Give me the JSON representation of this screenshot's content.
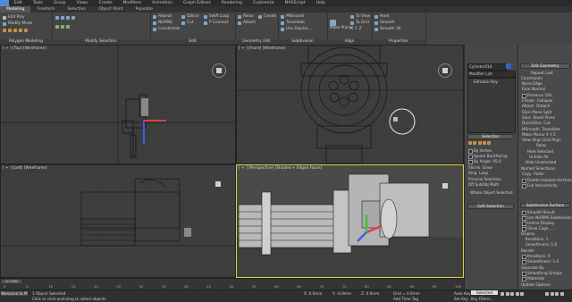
{
  "menu": [
    "Edit",
    "Tools",
    "Group",
    "Views",
    "Create",
    "Modifiers",
    "Animation",
    "Graph Editors",
    "Rendering",
    "Customize",
    "MAXScript",
    "Help"
  ],
  "tabs": [
    {
      "label": "Modeling",
      "active": true
    },
    {
      "label": "Freeform",
      "active": false
    },
    {
      "label": "Selection",
      "active": false
    },
    {
      "label": "Object Paint",
      "active": false
    },
    {
      "label": "Populate",
      "active": false
    }
  ],
  "ribbon": {
    "edit_poly_label": "Edit Poly",
    "modify_mode_label": "Modify Mode",
    "poly_groups": [
      "Polygon Modeling",
      "Modify Selection",
      "Edit",
      "Geometry (All)",
      "Subdivision",
      "Align",
      "Properties"
    ],
    "edit_buttons": [
      "Repeat",
      "QSlice",
      "Swift Loop",
      "NURMS",
      "Cut",
      "P Connect",
      "Constraints"
    ],
    "geometry_buttons": [
      "Relax",
      "Create",
      "Attach"
    ],
    "subdivision_buttons": [
      "MSmooth",
      "Tessellate",
      "Use Displac..."
    ],
    "align_buttons": [
      "Make Planar",
      "To View",
      "To Grid",
      "X",
      "Y",
      "Z"
    ],
    "properties_buttons": [
      "Hard",
      "Smooth",
      "Smooth 30"
    ]
  },
  "viewports": {
    "top": "[ + ] [Top] [Wireframe]",
    "front": "[ + ] [Front] [Wireframe]",
    "left": "[ + ] [Left] [Wireframe]",
    "perspective": "[ + ] [Perspective] [Shaded + Edged Faces]"
  },
  "command_panel": {
    "object_name": "Cylinder014",
    "modifier_list": "Modifier List",
    "stack_items": [
      "Editable Poly"
    ],
    "selection_title": "Selection",
    "by_vertex": "By Vertex",
    "ignore_backfacing": "Ignore Backfacing",
    "by_angle": "By Angle:",
    "by_angle_value": "45.0",
    "shrink": "Shrink",
    "grow": "Grow",
    "ring": "Ring",
    "loop": "Loop",
    "preview_selection": "Preview Selection",
    "preview_options": [
      "Off",
      "SubObj",
      "Multi"
    ],
    "whole_object_selected": "Whole Object Selected",
    "soft_selection": "Soft Selection"
  },
  "edit_geometry": {
    "title": "Edit Geometry",
    "repeat_last": "Repeat Last",
    "constraints": "Constraints",
    "constraint_options": [
      "None",
      "Edge",
      "Face",
      "Normal"
    ],
    "preserve_uvs": "Preserve UVs",
    "create": "Create",
    "collapse": "Collapse",
    "attach": "Attach",
    "detach": "Detach",
    "slice_plane": "Slice Plane",
    "split": "Split",
    "slice": "Slice",
    "reset_plane": "Reset Plane",
    "quickslice": "QuickSlice",
    "cut": "Cut",
    "msmooth": "MSmooth",
    "tessellate": "Tessellate",
    "make_planar": "Make Planar",
    "x": "X",
    "y": "Y",
    "z": "Z",
    "view_align": "View Align",
    "grid_align": "Grid Align",
    "relax": "Relax",
    "hide_selected": "Hide Selected",
    "unhide_all": "Unhide All",
    "hide_unselected": "Hide Unselected",
    "named_selections": "Named Selections:",
    "copy": "Copy",
    "paste": "Paste",
    "delete_isolated": "Delete Isolated Vertices",
    "full_interactivity": "Full Interactivity"
  },
  "subdivision_surface": {
    "title": "Subdivision Surface",
    "smooth_result": "Smooth Result",
    "use_nurms": "Use NURMS Subdivision",
    "isoline_display": "Isoline Display",
    "show_cage": "Show Cage......",
    "display": "Display",
    "iterations_label": "Iterations:",
    "iterations_value": "1",
    "smoothness_label": "Smoothness:",
    "smoothness_value": "1.0",
    "render": "Render",
    "render_iterations_value": "0",
    "render_smoothness_value": "1.0",
    "separate_by": "Separate By",
    "smoothing_groups": "Smoothing Groups",
    "materials": "Materials",
    "update_options": "Update Options"
  },
  "timeline": {
    "frame_display": "0 / 100",
    "ticks": [
      "0",
      "5",
      "10",
      "15",
      "20",
      "25",
      "30",
      "35",
      "40",
      "45",
      "50",
      "55",
      "60",
      "65",
      "70",
      "75",
      "80",
      "85",
      "90",
      "95",
      "100"
    ]
  },
  "status": {
    "welcome": "Welcome to M",
    "selected": "1 Object Selected",
    "prompt": "Click or click-and-drag to select objects",
    "x_label": "X:",
    "x_value": "0.0mm",
    "y_label": "Y:",
    "y_value": "-0.0mm",
    "z_label": "Z:",
    "z_value": "0.0mm",
    "grid": "Grid = 0.0mm",
    "auto_key": "Auto Key",
    "selected_field": "Selected",
    "set_key": "Set Key",
    "key_filters": "Key Filters...",
    "add_time_tag": "Add Time Tag"
  },
  "colors": {
    "active_border": "#e0d24a",
    "background": "#3b3b3b",
    "axis_x": "#e04040",
    "axis_y": "#40c040",
    "axis_z": "#4060e0"
  }
}
